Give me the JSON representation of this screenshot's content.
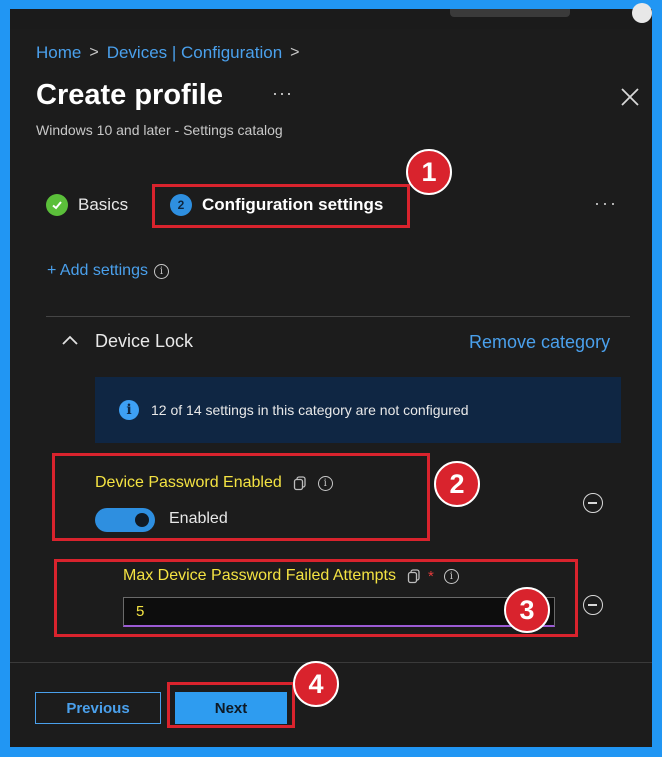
{
  "breadcrumb": {
    "home": "Home",
    "devices": "Devices | Configuration",
    "sep": ">"
  },
  "header": {
    "title": "Create profile",
    "more": "···",
    "subtitle": "Windows 10 and later - Settings catalog"
  },
  "wizard": {
    "steps": [
      {
        "label": "Basics",
        "status": "complete"
      },
      {
        "label": "Configuration settings",
        "number": "2",
        "status": "current"
      }
    ],
    "more": "···"
  },
  "add_settings": {
    "label": "+ Add settings",
    "info": "i"
  },
  "category": {
    "title": "Device Lock",
    "remove_label": "Remove category",
    "info_icon": "i",
    "info_message": "12 of 14 settings in this category are not configured"
  },
  "settings": [
    {
      "name": "Device Password Enabled",
      "info": "i",
      "toggle_on": true,
      "value_label": "Enabled"
    },
    {
      "name": "Max Device Password Failed Attempts",
      "required_mark": "*",
      "info": "i",
      "value": "5"
    }
  ],
  "footer": {
    "previous": "Previous",
    "next": "Next"
  },
  "annotations": [
    "1",
    "2",
    "3",
    "4"
  ],
  "colors": {
    "accent": "#2e9cf0",
    "link": "#4aa0ec",
    "highlight_text": "#f4e342",
    "annotation": "#d9232d",
    "frame": "#2196f3"
  }
}
